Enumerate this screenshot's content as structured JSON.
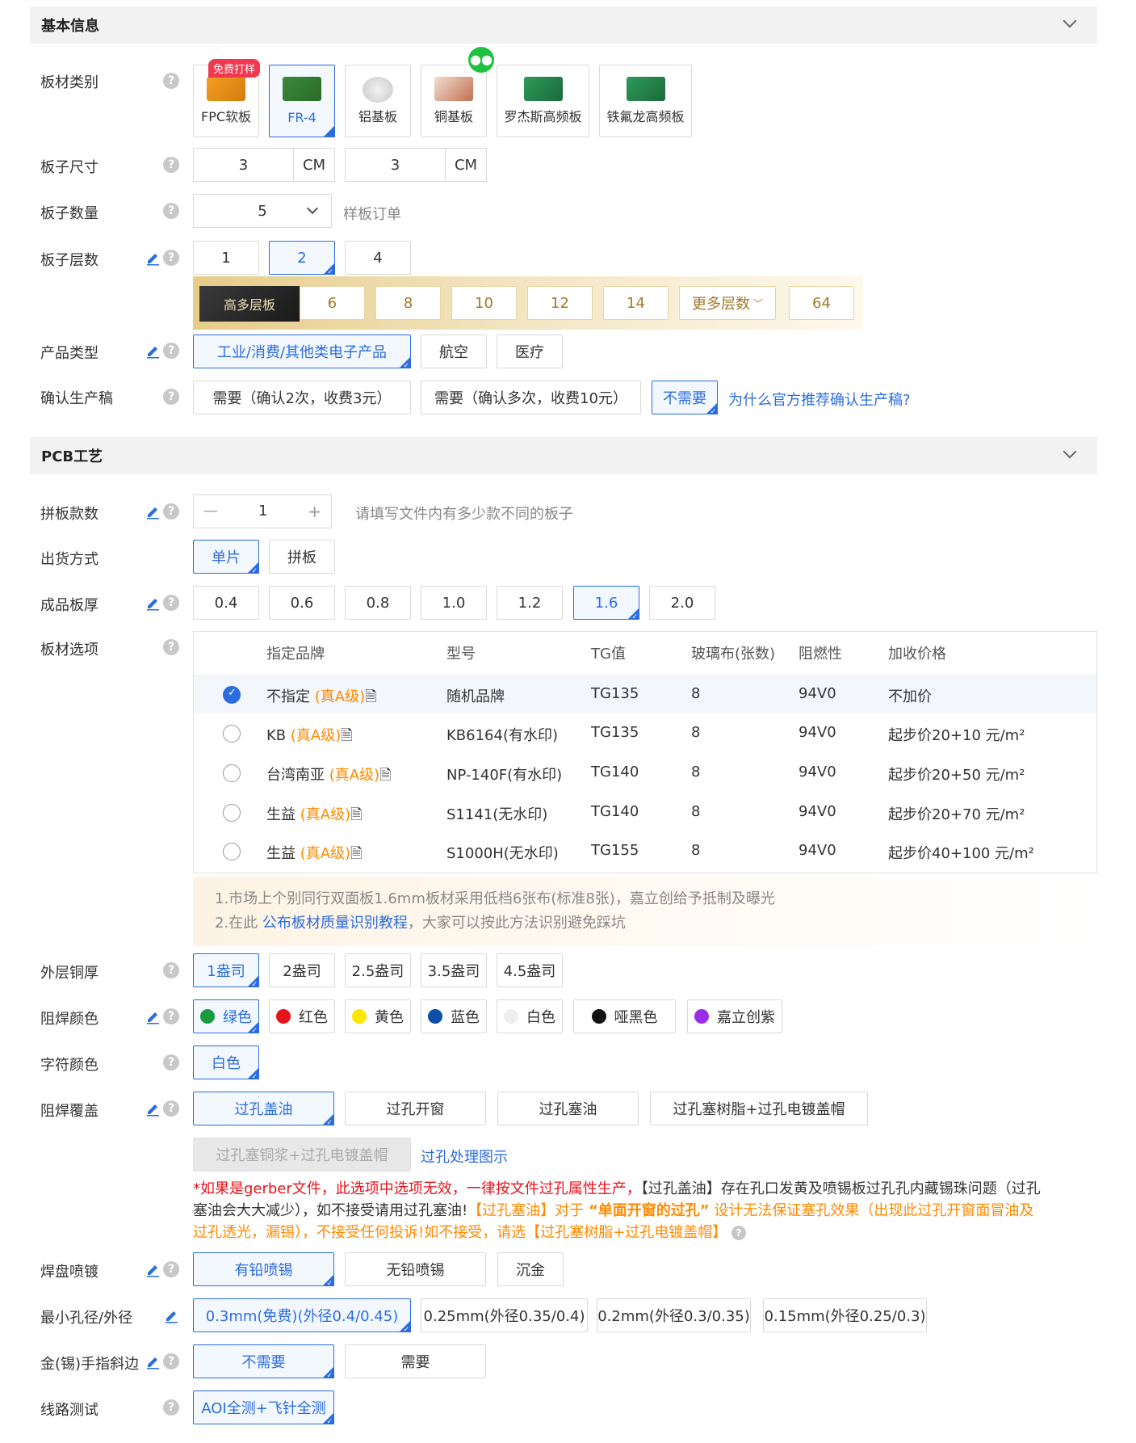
{
  "sections": {
    "basic": "基本信息",
    "pcb": "PCB工艺"
  },
  "labels": {
    "material": "板材类别",
    "size": "板子尺寸",
    "quantity": "板子数量",
    "layers": "板子层数",
    "product": "产品类型",
    "confirm": "确认生产稿",
    "panel_count": "拼板款数",
    "delivery": "出货方式",
    "thickness": "成品板厚",
    "board_option": "板材选项",
    "copper": "外层铜厚",
    "mask_color": "阻焊颜色",
    "silk_color": "字符颜色",
    "mask_cover": "阻焊覆盖",
    "surface": "焊盘喷镀",
    "min_hole": "最小孔径/外径",
    "finger": "金(锡)手指斜边",
    "test": "线路测试"
  },
  "help": "?",
  "materials": [
    {
      "label": "FPC软板",
      "badge": "免费打样"
    },
    {
      "label": "FR-4"
    },
    {
      "label": "铝基板"
    },
    {
      "label": "铜基板"
    },
    {
      "label": "罗杰斯高频板"
    },
    {
      "label": "铁氟龙高频板"
    }
  ],
  "size": {
    "w": "3",
    "h": "3",
    "unit": "CM"
  },
  "quantity": {
    "value": "5",
    "hint": "样板订单"
  },
  "layers": [
    "1",
    "2",
    "4"
  ],
  "high_layers": {
    "tag": "高多层板",
    "options": [
      "6",
      "8",
      "10",
      "12",
      "14",
      "更多层数",
      "64"
    ]
  },
  "product_types": [
    "工业/消费/其他类电子产品",
    "航空",
    "医疗"
  ],
  "confirm_opts": [
    "需要（确认2次，收费3元）",
    "需要（确认多次，收费10元）",
    "不需要"
  ],
  "confirm_link": "为什么官方推荐确认生产稿?",
  "panel": {
    "minus": "—",
    "value": "1",
    "plus": "+",
    "hint": "请填写文件内有多少款不同的板子"
  },
  "delivery": [
    "单片",
    "拼板"
  ],
  "thickness": [
    "0.4",
    "0.6",
    "0.8",
    "1.0",
    "1.2",
    "1.6",
    "2.0"
  ],
  "table": {
    "headers": [
      "指定品牌",
      "型号",
      "TG值",
      "玻璃布(张数)",
      "阻燃性",
      "加收价格"
    ],
    "rows": [
      {
        "brand": "不指定",
        "grade": "(真A级)",
        "model": "随机品牌",
        "tg": "TG135",
        "glass": "8",
        "fire": "94V0",
        "price": "不加价"
      },
      {
        "brand": "KB",
        "grade": "(真A级)",
        "model": "KB6164(有水印)",
        "tg": "TG135",
        "glass": "8",
        "fire": "94V0",
        "price": "起步价20+10 元/m²"
      },
      {
        "brand": "台湾南亚",
        "grade": "(真A级)",
        "model": "NP-140F(有水印)",
        "tg": "TG140",
        "glass": "8",
        "fire": "94V0",
        "price": "起步价20+50 元/m²"
      },
      {
        "brand": "生益",
        "grade": "(真A级)",
        "model": "S1141(无水印)",
        "tg": "TG140",
        "glass": "8",
        "fire": "94V0",
        "price": "起步价20+70 元/m²"
      },
      {
        "brand": "生益",
        "grade": "(真A级)",
        "model": "S1000H(无水印)",
        "tg": "TG155",
        "glass": "8",
        "fire": "94V0",
        "price": "起步价40+100 元/m²"
      }
    ]
  },
  "notes": {
    "line1": "1.市场上个别同行双面板1.6mm板材采用低档6张布(标准8张)，嘉立创给予抵制及曝光",
    "line2_pre": "2.在此",
    "line2_link": "公布板材质量识别教程",
    "line2_post": "，大家可以按此方法识别避免踩坑"
  },
  "copper": [
    "1盎司",
    "2盎司",
    "2.5盎司",
    "3.5盎司",
    "4.5盎司"
  ],
  "mask_colors": [
    {
      "label": "绿色",
      "color": "#1a9a3c"
    },
    {
      "label": "红色",
      "color": "#e8121a"
    },
    {
      "label": "黄色",
      "color": "#ffe600"
    },
    {
      "label": "蓝色",
      "color": "#0c4ea8"
    },
    {
      "label": "白色",
      "color": "#eeeeee"
    },
    {
      "label": "哑黑色",
      "color": "#111111"
    },
    {
      "label": "嘉立创紫",
      "color": "#9a2ee6"
    }
  ],
  "silk": [
    "白色"
  ],
  "mask_cover": [
    "过孔盖油",
    "过孔开窗",
    "过孔塞油",
    "过孔塞树脂+过孔电镀盖帽",
    "过孔塞铜浆+过孔电镀盖帽"
  ],
  "mask_cover_link": "过孔处理图示",
  "warning": {
    "p1": "*如果是gerber文件，此选项中选项无效，一律按文件过孔属性生产，",
    "p2": "【过孔盖油】存在孔口发黄及喷锡板过孔孔内藏锡珠问题（过孔",
    "p3": "塞油会大大减少），如不接受请用过孔塞油!",
    "p4": "【过孔塞油】对于",
    "p5": "“单面开窗的过孔”",
    "p6": "设计无法保证塞孔效果（出现此过孔开窗面冒油及",
    "p7": "过孔透光，漏锡），不接受任何投诉!如不接受，请选【过孔塞树脂+过孔电镀盖帽】"
  },
  "surface": [
    "有铅喷锡",
    "无铅喷锡",
    "沉金"
  ],
  "min_hole": [
    "0.3mm(免费)(外径0.4/0.45)",
    "0.25mm(外径0.35/0.4)",
    "0.2mm(外径0.3/0.35)",
    "0.15mm(外径0.25/0.3)"
  ],
  "finger": [
    "不需要",
    "需要"
  ],
  "test": [
    "AOI全测+飞针全测"
  ]
}
